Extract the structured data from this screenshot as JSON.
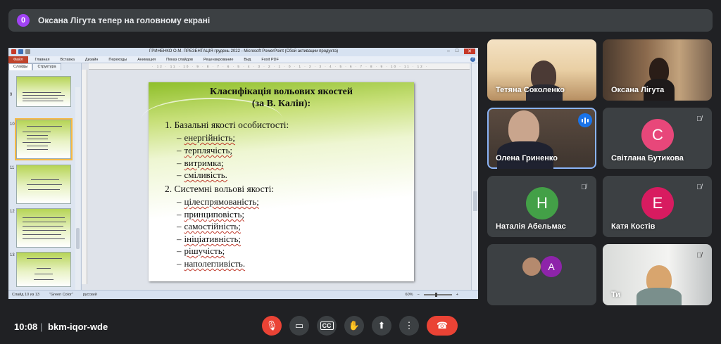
{
  "banner": {
    "badge": "0",
    "text": "Оксана Лігута тепер на головному екрані",
    "badge_color": "#a142f4"
  },
  "presentation": {
    "window_title": "ГРИНЕНКО О.М. ПРЕЗЕНТАЦІЯ  грудень 2022  -  Microsoft PowerPoint (Сбой активации продукта)",
    "ribbon_tabs": [
      "Файл",
      "Главная",
      "Вставка",
      "Дизайн",
      "Переходы",
      "Анимация",
      "Показ слайдов",
      "Рецензирование",
      "Вид",
      "Foxit PDF"
    ],
    "left_tabs": [
      "Слайды",
      "Структура"
    ],
    "thumbnails": [
      {
        "num": "9",
        "selected": false
      },
      {
        "num": "10",
        "selected": true
      },
      {
        "num": "11",
        "selected": false
      },
      {
        "num": "12",
        "selected": false
      },
      {
        "num": "13",
        "selected": false
      }
    ],
    "slide": {
      "title_line1": "Класифікація вольових якостей",
      "title_line2": "(за В. Калін):",
      "section1": "1. Базальні якості особистості:",
      "items1": [
        "енергійність;",
        "терплячість;",
        "витримка;",
        "сміливість."
      ],
      "section2": "2. Системні вольові якості:",
      "items2": [
        "цілеспрямованість;",
        "принциповість;",
        "самостійність;",
        "ініціативність;",
        "рішучість;",
        "наполегливість."
      ]
    },
    "status": {
      "slide_info": "Слайд 10 из 13",
      "theme": "\"Green Color\"",
      "language": "русский",
      "zoom": "60%"
    }
  },
  "participants": [
    {
      "name": "Тетяна Соколенко",
      "type": "video",
      "muted": false
    },
    {
      "name": "Оксана Лігута",
      "type": "video",
      "muted": false
    },
    {
      "name": "Олена Гриненко",
      "type": "video",
      "muted": false,
      "speaking": true
    },
    {
      "name": "Світлана Бутикова",
      "type": "avatar",
      "initial": "С",
      "color": "#e8477a",
      "muted": true
    },
    {
      "name": "Наталія Абельмас",
      "type": "avatar",
      "initial": "Н",
      "color": "#43a047",
      "muted": true
    },
    {
      "name": "Катя Костів",
      "type": "avatar",
      "initial": "Е",
      "color": "#d81b60",
      "muted": true
    },
    {
      "name": "",
      "type": "group",
      "initial": "А",
      "color": "#8e24aa",
      "muted": false
    },
    {
      "name": "Ти",
      "type": "video",
      "muted": true
    }
  ],
  "bottom": {
    "time": "10:08",
    "separator": "|",
    "meeting_code": "bkm-iqor-wde"
  },
  "controls": [
    {
      "name": "mic-off",
      "glyph": "🎤̸"
    },
    {
      "name": "camera",
      "glyph": "▭"
    },
    {
      "name": "captions",
      "glyph": "CC"
    },
    {
      "name": "raise-hand",
      "glyph": "✋"
    },
    {
      "name": "present",
      "glyph": "⬆"
    },
    {
      "name": "more",
      "glyph": "⋮"
    },
    {
      "name": "end-call",
      "glyph": "☎"
    }
  ]
}
